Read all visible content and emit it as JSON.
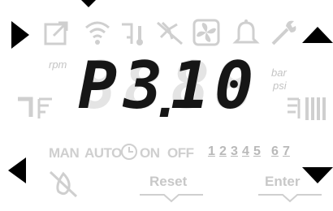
{
  "display": {
    "digits": [
      "P",
      "3",
      "1",
      "0"
    ],
    "ghost_digit": "8",
    "decimal_point": ".",
    "units_left": "rpm",
    "units_right_top": "bar",
    "units_right_bottom": "psi"
  },
  "icons_top": [
    "open-external-icon",
    "wifi-icon",
    "temperature-icon",
    "fan-off-icon",
    "fan-box-icon",
    "bell-icon",
    "wrench-icon"
  ],
  "modes": {
    "man": "MAN",
    "auto": "AUTO",
    "on": "ON",
    "off": "OFF"
  },
  "numbers": [
    "1",
    "2",
    "3",
    "4",
    "5",
    "6",
    "7"
  ],
  "softkeys": {
    "reset": "Reset",
    "enter": "Enter"
  },
  "colors": {
    "active": "#161616",
    "inactive": "#cfcfcf",
    "arrow": "#000000"
  }
}
